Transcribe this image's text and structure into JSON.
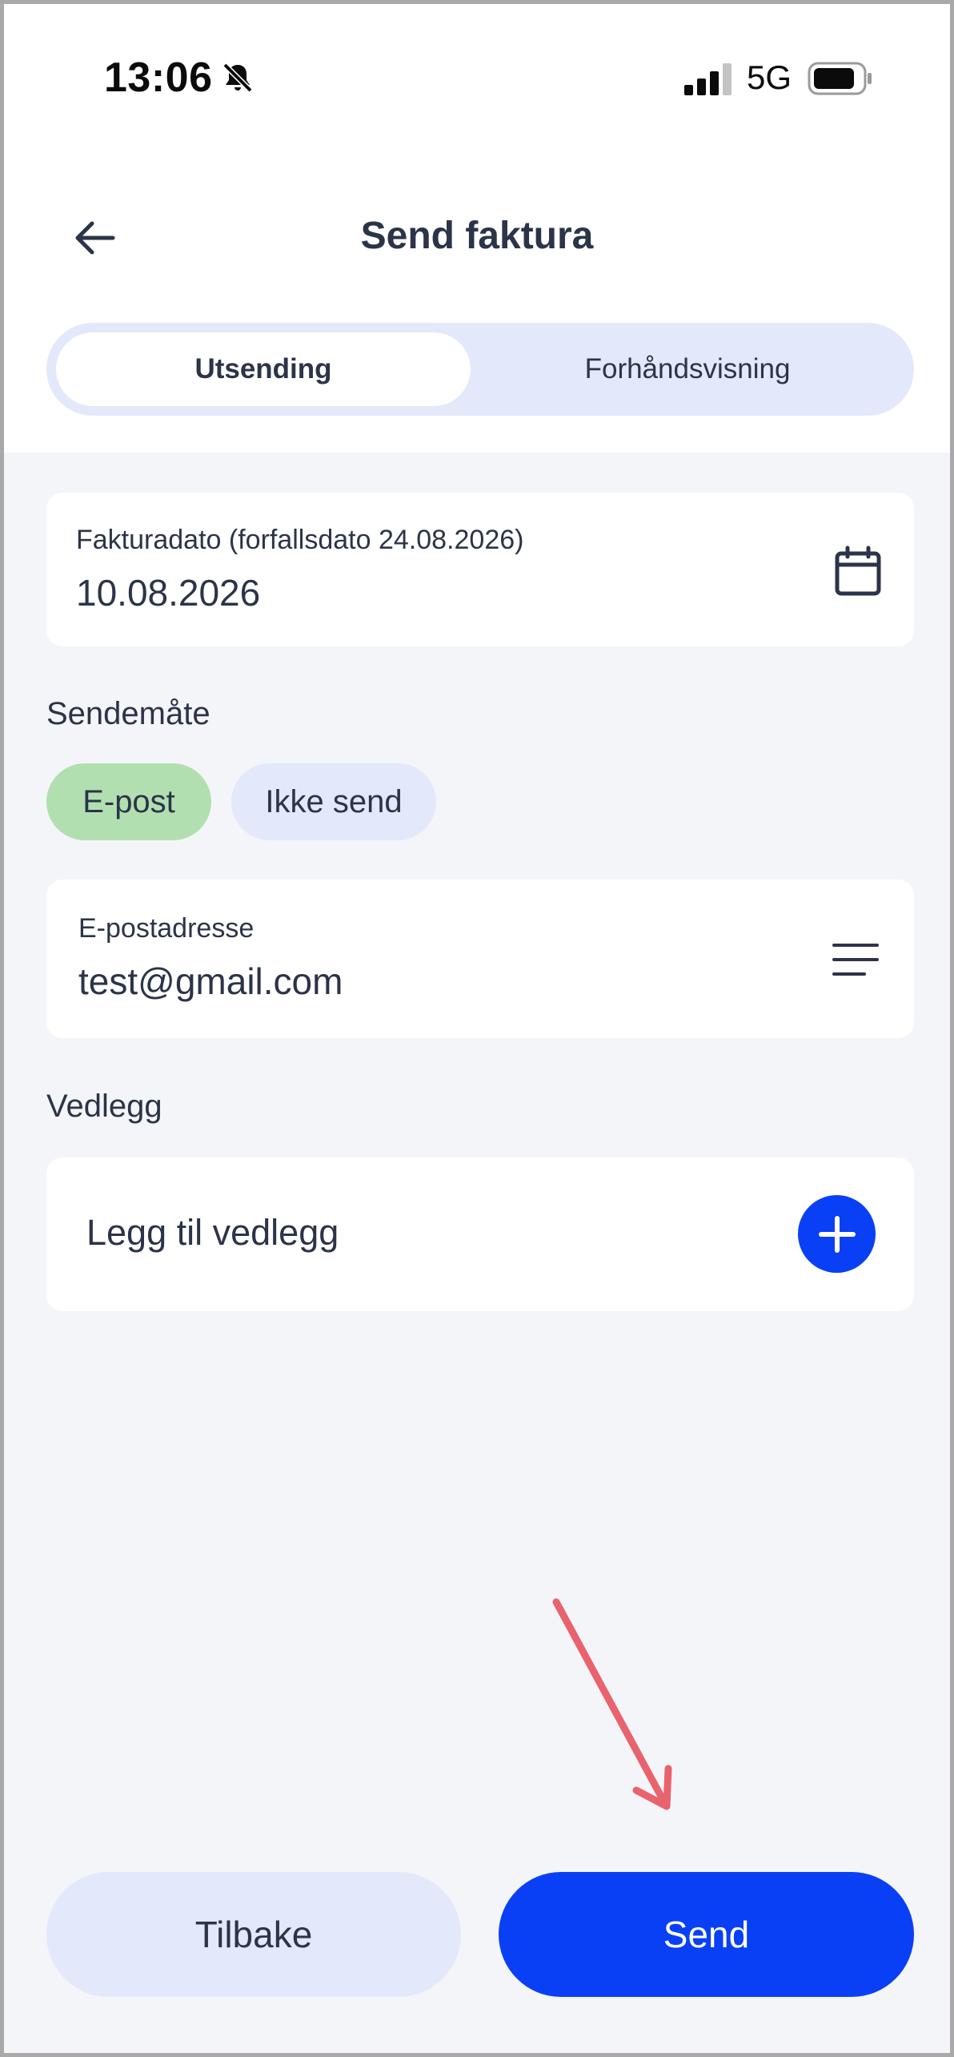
{
  "status_bar": {
    "time": "13:06",
    "network": "5G",
    "icons": [
      "bell-muted-icon",
      "signal-icon",
      "battery-icon"
    ]
  },
  "header": {
    "title": "Send faktura",
    "back_icon": "arrow-left-icon"
  },
  "tabs": [
    {
      "label": "Utsending",
      "active": true
    },
    {
      "label": "Forhåndsvisning",
      "active": false
    }
  ],
  "invoice_date": {
    "label": "Fakturadato (forfallsdato 24.08.2026)",
    "value": "10.08.2026",
    "icon": "calendar-icon"
  },
  "send_method": {
    "label": "Sendemåte",
    "options": [
      {
        "label": "E-post",
        "selected": true
      },
      {
        "label": "Ikke send",
        "selected": false
      }
    ]
  },
  "email": {
    "label": "E-postadresse",
    "value": "test@gmail.com",
    "icon": "menu-lines-icon"
  },
  "attachments": {
    "label": "Vedlegg",
    "add_label": "Legg til vedlegg",
    "add_icon": "plus-icon"
  },
  "buttons": {
    "back": "Tilbake",
    "send": "Send"
  },
  "colors": {
    "primary": "#0a40f5",
    "chip_selected": "#b2dfb0",
    "chip_unselected": "#e3e8fb",
    "text": "#2b3448",
    "background": "#f4f5f9",
    "annotation_arrow": "#e8636e"
  }
}
